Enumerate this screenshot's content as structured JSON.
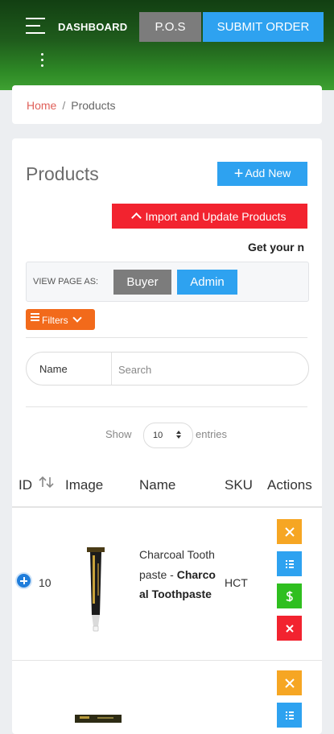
{
  "header": {
    "brand": "DASHBOARD",
    "pos_label": "P.O.S",
    "submit_label": "SUBMIT ORDER",
    "gradient_colors": [
      "#123f12",
      "#3fa132"
    ]
  },
  "breadcrumb": {
    "home": "Home",
    "separator": "/",
    "current": "Products"
  },
  "page": {
    "title": "Products",
    "add_new_label": "Add New",
    "import_label": "Import and Update Products",
    "promo_text": "Get your n",
    "view_as_label": "VIEW PAGE AS:",
    "buyer_label": "Buyer",
    "admin_label": "Admin",
    "filters_label": "Filters"
  },
  "search": {
    "field_label": "Name",
    "placeholder": "Search"
  },
  "entries": {
    "show_label": "Show",
    "value": "10",
    "entries_label": "entries"
  },
  "table": {
    "headers": [
      "ID",
      "Image",
      "Name",
      "SKU",
      "Actions"
    ],
    "rows": [
      {
        "id": "10",
        "name": "Charcoal Toothpaste",
        "separator": " - ",
        "name_bold": "Charcoal Toothpaste",
        "sku": "HCT",
        "actions": [
          "close-icon",
          "list-icon",
          "money-icon",
          "delete-icon"
        ]
      },
      {
        "actions": [
          "close-icon",
          "list-icon"
        ]
      }
    ]
  },
  "colors": {
    "primary_blue": "#2ea2f0",
    "danger_red": "#f2232f",
    "warning_orange": "#f6a623",
    "success_green": "#2fbf1f",
    "filters_orange": "#f26a1b",
    "neutral_gray": "#7c7c7c",
    "breadcrumb_home": "#e0605a"
  }
}
